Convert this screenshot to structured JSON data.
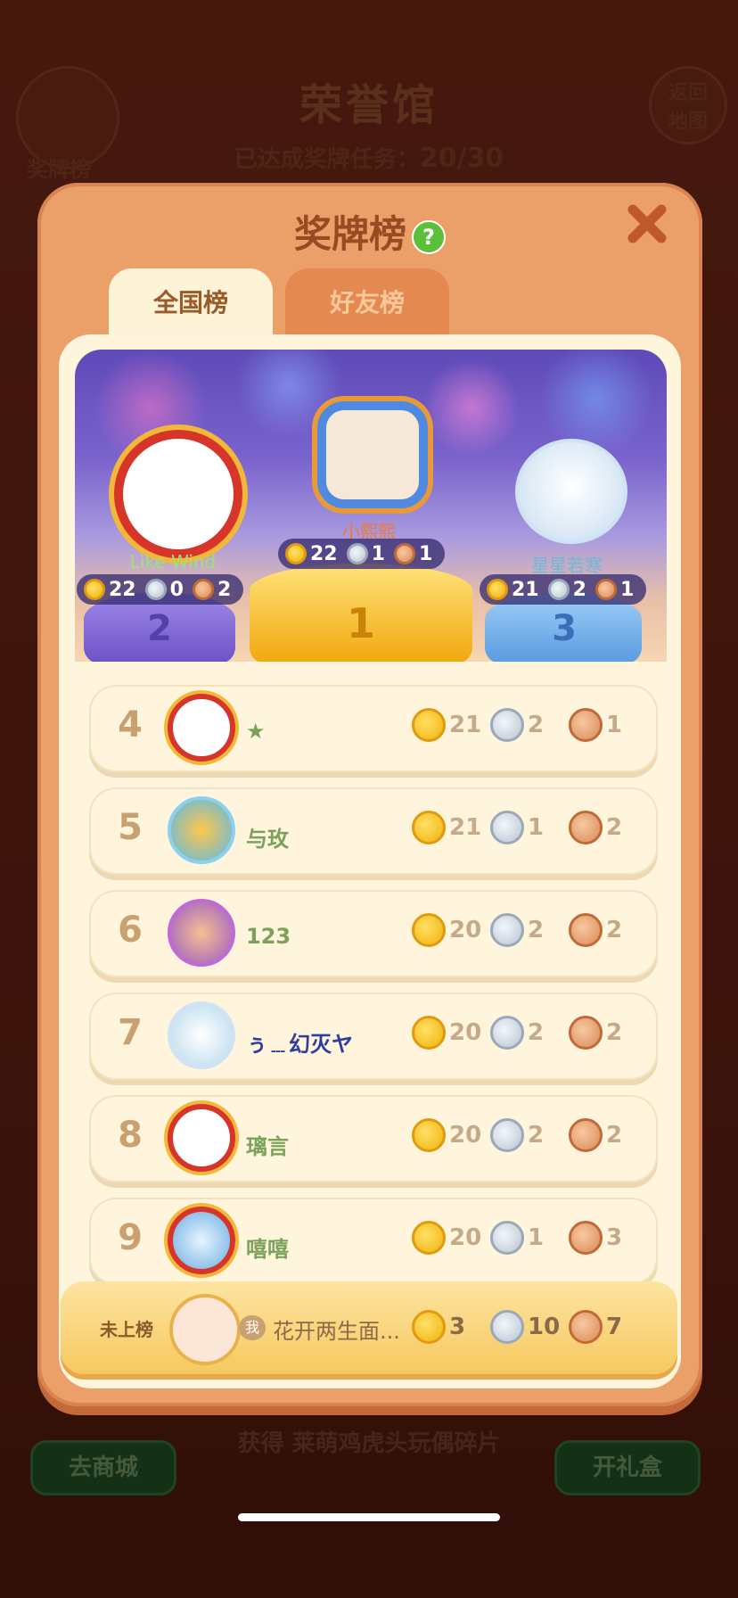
{
  "background": {
    "title": "荣誉馆",
    "medal_progress_label": "已达成奖牌任务：",
    "medal_progress_value": "20/30",
    "left_button_label": "奖牌榜",
    "back_label": "返回地图",
    "shop_button": "去商城",
    "gift_button": "开礼盒",
    "reward_text": "获得 莱萌鸡虎头玩偶碎片"
  },
  "panel": {
    "title": "奖牌榜",
    "tabs": [
      {
        "label": "全国榜",
        "active": true
      },
      {
        "label": "好友榜",
        "active": false
      }
    ]
  },
  "podium": [
    {
      "place": "2",
      "name": "Like Wind",
      "gold": "22",
      "silver": "0",
      "bronze": "2"
    },
    {
      "place": "1",
      "name": "小熙熙",
      "gold": "22",
      "silver": "1",
      "bronze": "1"
    },
    {
      "place": "3",
      "name": "星星若寒",
      "gold": "21",
      "silver": "2",
      "bronze": "1"
    }
  ],
  "rankings": [
    {
      "rank": "4",
      "name": "★",
      "gold": "21",
      "silver": "2",
      "bronze": "1"
    },
    {
      "rank": "5",
      "name": "与玫",
      "gold": "21",
      "silver": "1",
      "bronze": "2"
    },
    {
      "rank": "6",
      "name": "123",
      "gold": "20",
      "silver": "2",
      "bronze": "2"
    },
    {
      "rank": "7",
      "name": "ぅ﹍幻灭ヤ",
      "gold": "20",
      "silver": "2",
      "bronze": "2"
    },
    {
      "rank": "8",
      "name": "璃言",
      "gold": "20",
      "silver": "2",
      "bronze": "2"
    },
    {
      "rank": "9",
      "name": "嘻嘻",
      "gold": "20",
      "silver": "1",
      "bronze": "3"
    }
  ],
  "me": {
    "status": "未上榜",
    "badge": "我",
    "name": "花开两生面...",
    "gold": "3",
    "silver": "10",
    "bronze": "7"
  },
  "colors": {
    "gold": "#f0b20a",
    "silver": "#b8c4d2",
    "bronze": "#d98a58",
    "panel": "#eba069"
  }
}
